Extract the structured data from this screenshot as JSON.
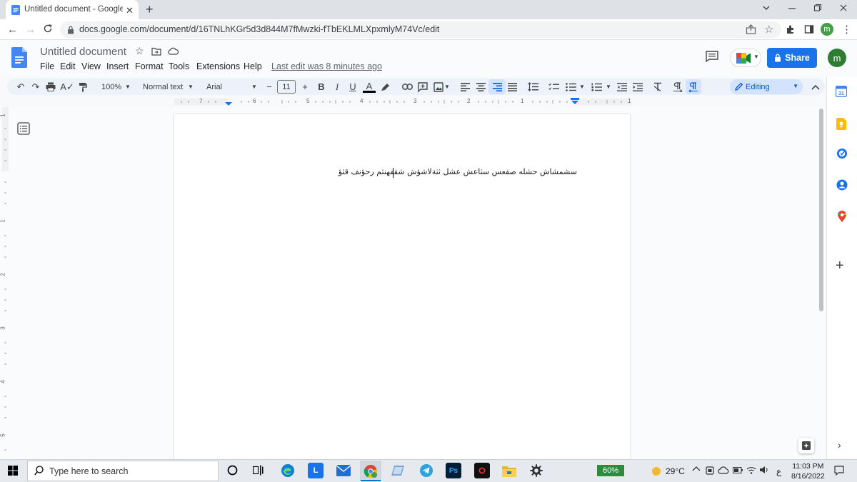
{
  "browser": {
    "tab_title": "Untitled document - Google Do",
    "url": "docs.google.com/document/d/16TNLhKGr5d3d844M7fMwzki-fTbEKLMLXpxmlyM74Vc/edit",
    "profile_initial": "m"
  },
  "docs": {
    "title": "Untitled document",
    "menus": [
      "File",
      "Edit",
      "View",
      "Insert",
      "Format",
      "Tools",
      "Extensions",
      "Help"
    ],
    "last_edit": "Last edit was 8 minutes ago",
    "share_label": "Share",
    "user_initial": "m"
  },
  "toolbar": {
    "zoom": "100%",
    "style": "Normal text",
    "font": "Arial",
    "font_size": "11",
    "bold": "B",
    "italic": "I",
    "underline": "U",
    "text_color": "A",
    "mode": "Editing"
  },
  "ruler": {
    "labels": [
      "7",
      "6",
      "5",
      "4",
      "3",
      "2",
      "1",
      "1"
    ],
    "vertical_labels": [
      "1",
      "1",
      "2",
      "3",
      "4",
      "5"
    ]
  },
  "document": {
    "text": "سشمشاش حشله صقعس سثاعش عشل ثثةلاشؤش شقفهنثم رحؤنف قثؤ"
  },
  "taskbar": {
    "search_placeholder": "Type here to search",
    "battery": "60%",
    "temperature": "29°C",
    "language": "ع",
    "time": "11:03 PM",
    "date": "8/16/2022"
  },
  "colors": {
    "accent": "#1a73e8",
    "avatar": "#2e7d32",
    "toolbar_bg": "#edf2fa",
    "editing_bg": "#d3e3fd"
  }
}
